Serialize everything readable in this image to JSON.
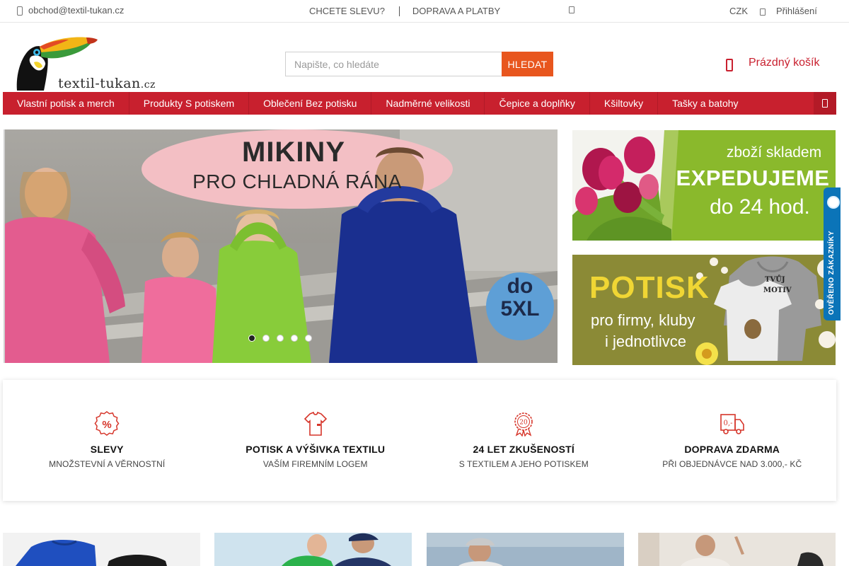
{
  "topbar": {
    "email": "obchod@textil-tukan.cz",
    "discount_link": "CHCETE SLEVU?",
    "shipping_link": "DOPRAVA A PLATBY",
    "currency": "CZK",
    "login": "Přihlášení"
  },
  "header": {
    "logo_text": "textil-tukan",
    "logo_tld": ".cz",
    "search_placeholder": "Napište, co hledáte",
    "search_button": "HLEDAT",
    "cart_label": "Prázdný košík"
  },
  "nav": {
    "items": [
      "Vlastní potisk a merch",
      "Produkty S potiskem",
      "Oblečení Bez potisku",
      "Nadměrné velikosti",
      "Čepice a doplňky",
      "Kšiltovky",
      "Tašky a batohy"
    ]
  },
  "hero": {
    "title": "MIKINY",
    "subtitle": "PRO CHLADNÁ RÁNA",
    "badge_line1": "do",
    "badge_line2": "5XL",
    "slides": 5,
    "active_slide": 1
  },
  "side_banners": {
    "b1": {
      "line1": "zboží skladem",
      "line2": "EXPEDUJEME",
      "line3": "do 24 hod."
    },
    "b2": {
      "title": "POTISK",
      "line1": "pro firmy, kluby",
      "line2": "i jednotlivce",
      "shirt_text1": "TVŮJ",
      "shirt_text2": "MOTIV"
    }
  },
  "verified_badge": "OVĚŘENO ZÁKAZNÍKY",
  "features": [
    {
      "icon": "percent-badge-icon",
      "title": "SLEVY",
      "sub": "MNOŽSTEVNÍ A VĚRNOSTNÍ"
    },
    {
      "icon": "tshirt-print-icon",
      "title": "POTISK A VÝŠIVKA TEXTILU",
      "sub": "VAŠÍM FIREMNÍM LOGEM"
    },
    {
      "icon": "rosette-20-icon",
      "title": "24 LET ZKUŠENOSTÍ",
      "sub": "S TEXTILEM A JEHO POTISKEM"
    },
    {
      "icon": "delivery-truck-icon",
      "title": "DOPRAVA ZDARMA",
      "sub": "PŘI OBJEDNÁVCE NAD 3.000,- KČ"
    }
  ],
  "colors": {
    "brand_red": "#c8202e",
    "search_orange": "#e8561e",
    "icon_red": "#d6352a"
  }
}
